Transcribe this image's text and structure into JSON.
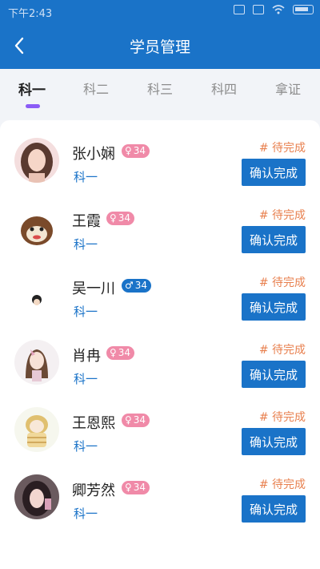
{
  "status_bar": {
    "time": "下午2:43"
  },
  "app_bar": {
    "title": "学员管理"
  },
  "tabs": [
    {
      "label": "科一",
      "active": true
    },
    {
      "label": "科二",
      "active": false
    },
    {
      "label": "科三",
      "active": false
    },
    {
      "label": "科四",
      "active": false
    },
    {
      "label": "拿证",
      "active": false
    }
  ],
  "students": [
    {
      "name": "张小娴",
      "gender": "female",
      "age": "34",
      "subject": "科一",
      "status": "# 待完成",
      "action": "确认完成"
    },
    {
      "name": "王霞",
      "gender": "female",
      "age": "34",
      "subject": "科一",
      "status": "# 待完成",
      "action": "确认完成"
    },
    {
      "name": "吴一川",
      "gender": "male",
      "age": "34",
      "subject": "科一",
      "status": "# 待完成",
      "action": "确认完成"
    },
    {
      "name": "肖冉",
      "gender": "female",
      "age": "34",
      "subject": "科一",
      "status": "# 待完成",
      "action": "确认完成"
    },
    {
      "name": "王恩熙",
      "gender": "female",
      "age": "34",
      "subject": "科一",
      "status": "# 待完成",
      "action": "确认完成"
    },
    {
      "name": "卿芳然",
      "gender": "female",
      "age": "34",
      "subject": "科一",
      "status": "# 待完成",
      "action": "确认完成"
    }
  ],
  "symbols": {
    "female": "♀",
    "male": "♂"
  },
  "colors": {
    "primary": "#1a73c8",
    "accent": "#8b5cf6",
    "status": "#e8804f",
    "female_badge": "#f08aa8"
  }
}
